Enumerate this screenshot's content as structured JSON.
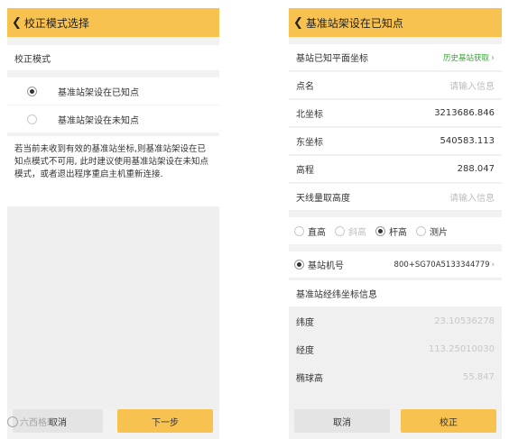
{
  "left": {
    "title": "校正模式选择",
    "section_label": "校正模式",
    "option_known": "基准站架设在已知点",
    "option_unknown": "基准站架设在未知点",
    "note": "若当前未收到有效的基准站坐标,则基准站架设在已知点模式不可用, 此时建议使用基准站架设在未知点模式，或者退出程序重启主机重新连接.",
    "cancel_label": "取消",
    "next_label": "下一步"
  },
  "right": {
    "title": "基准站架设在已知点",
    "plane_coord_label": "基站已知平面坐标",
    "history_link": "历史基站获取",
    "point_name_label": "点名",
    "point_name_placeholder": "请输入信息",
    "north_label": "北坐标",
    "north_value": "3213686.846",
    "east_label": "东坐标",
    "east_value": "540583.113",
    "elevation_label": "高程",
    "elevation_value": "288.047",
    "antenna_label": "天线量取高度",
    "antenna_placeholder": "请输入信息",
    "antenna_options": [
      "直高",
      "斜高",
      "杆高",
      "测片"
    ],
    "antenna_selected": "杆高",
    "base_id_label": "基站机号",
    "base_id_value": "800+SG70A5133344779",
    "latlon_section": "基准站经纬坐标信息",
    "lat_label": "纬度",
    "lat_value": "23.10536278",
    "lon_label": "经度",
    "lon_value": "113.25010030",
    "ell_label": "椭球高",
    "ell_value": "55.847",
    "cancel_label": "取消",
    "confirm_label": "校正"
  },
  "watermark": "六西格玛"
}
